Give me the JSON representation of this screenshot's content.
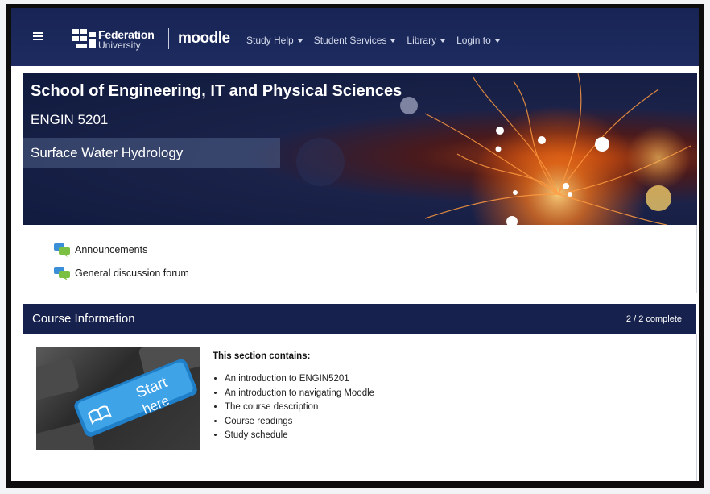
{
  "navbar": {
    "logo": {
      "name": "Federation",
      "sub": "University"
    },
    "moodle": "moodle",
    "menu": [
      {
        "label": "Study Help"
      },
      {
        "label": "Student Services"
      },
      {
        "label": "Library"
      },
      {
        "label": "Login to"
      }
    ]
  },
  "header": {
    "school": "School of Engineering, IT and Physical Sciences",
    "course_code": "ENGIN 5201",
    "course_name": "Surface Water Hydrology"
  },
  "forums": [
    {
      "label": "Announcements",
      "icon": "forum-icon"
    },
    {
      "label": "General discussion forum",
      "icon": "forum-icon"
    }
  ],
  "course_info": {
    "title": "Course Information",
    "progress": "2 / 2  complete",
    "image": {
      "text_line1": "Start",
      "text_line2": "here"
    },
    "heading": "This section contains:",
    "items": [
      "An introduction to ENGIN5201",
      "An introduction to navigating Moodle",
      "The course description",
      "Course readings",
      "Study schedule"
    ]
  },
  "colors": {
    "navbar": "#1d2b60",
    "section_header": "#16224d",
    "accent_orange": "#f07a20"
  }
}
